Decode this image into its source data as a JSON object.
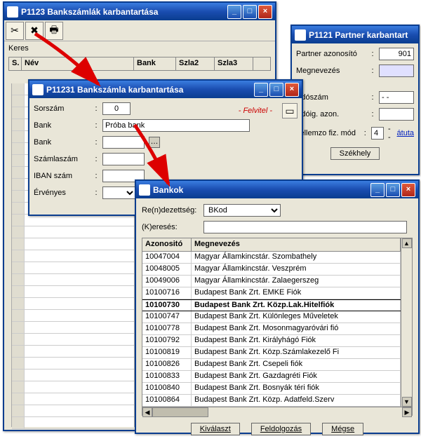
{
  "main_window": {
    "title": "P1123 Bankszámlák karbantartása",
    "search_label": "Keres",
    "columns": [
      "S.",
      "Név",
      "Bank",
      "Szla2",
      "Szla3"
    ]
  },
  "partner_window": {
    "title": "P1121 Partner karbantart",
    "fields": {
      "id_label": "Partner azonosító",
      "id_value": "901",
      "name_label": "Megnevezés",
      "name_value": "",
      "ado_label": "Adószám",
      "ado_value": "- -",
      "adoig_label": "Adóig. azon.",
      "fiz_label": "Jellemzo fiz. mód",
      "fiz_value": "4",
      "fiz_link": "átuta",
      "szekhely_btn": "Székhely"
    }
  },
  "edit_window": {
    "title": "P11231 Bankszámla karbantartása",
    "mode": "- Felvitel -",
    "fields": {
      "sorszam_label": "Sorszám",
      "sorszam_value": "0",
      "bank1_label": "Bank",
      "bank1_value": "Próba bank",
      "bank2_label": "Bank",
      "bank2_value": "",
      "szamlaszam_label": "Számlaszám",
      "iban_label": "IBAN szám",
      "ervenyes_label": "Érvényes"
    }
  },
  "bankok_window": {
    "title": "Bankok",
    "sort_label": "Re(n)dezettség:",
    "sort_value": "BKod",
    "search_label": "(K)eresés:",
    "search_value": "",
    "columns": [
      "Azonositó",
      "Megnevezés"
    ],
    "chart_data": {
      "type": "table",
      "columns": [
        "Azonositó",
        "Megnevezés"
      ],
      "rows": [
        [
          "10047004",
          "Magyar Államkincstár. Szombathely"
        ],
        [
          "10048005",
          "Magyar Államkincstár. Veszprém"
        ],
        [
          "10049006",
          "Magyar Államkincstár. Zalaegerszeg"
        ],
        [
          "10100716",
          "Budapest Bank Zrt. EMKE Fiók"
        ],
        [
          "10100730",
          "Budapest Bank Zrt. Közp.Lak.Hitelfiók"
        ],
        [
          "10100747",
          "Budapest Bank Zrt. Különleges Műveletek"
        ],
        [
          "10100778",
          "Budapest Bank Zrt. Mosonmagyaróvári fió"
        ],
        [
          "10100792",
          "Budapest Bank Zrt. Királyhágó Fiók"
        ],
        [
          "10100819",
          "Budapest Bank Zrt. Közp.Számlakezelő Fi"
        ],
        [
          "10100826",
          "Budapest Bank Zrt. Csepeli fiók"
        ],
        [
          "10100833",
          "Budapest Bank Zrt. Gazdagréti Fiók"
        ],
        [
          "10100840",
          "Budapest Bank Zrt. Bosnyák téri fiók"
        ],
        [
          "10100864",
          "Budapest Bank Zrt. Közp. Adatfeld.Szerv"
        ]
      ],
      "selected_index": 4
    },
    "buttons": {
      "select": "Kiválaszt",
      "process": "Feldolgozás",
      "cancel": "Mégse"
    }
  }
}
